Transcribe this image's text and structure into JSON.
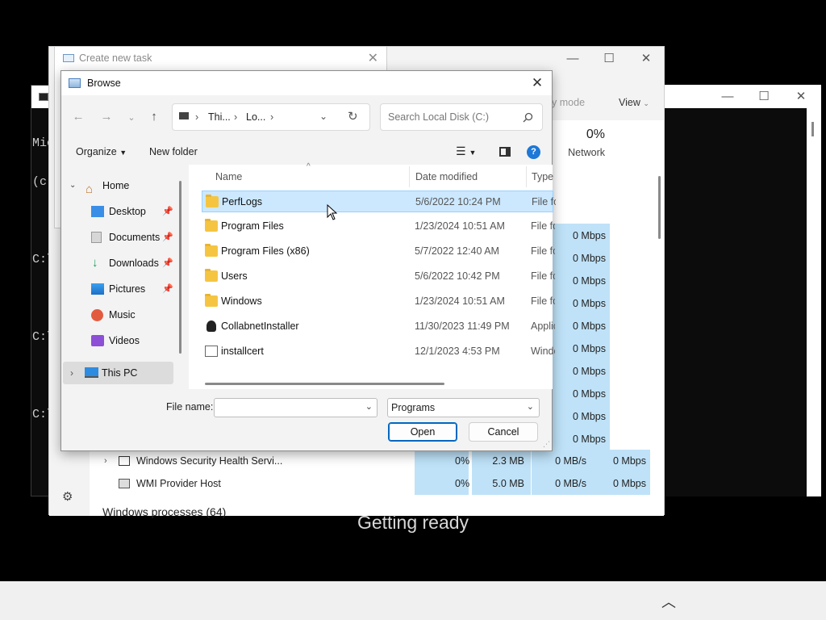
{
  "cmd": {
    "lines": [
      "Mic",
      "(c)",
      "",
      "C:\\",
      "",
      "C:\\",
      "",
      "C:\\"
    ]
  },
  "terminal": {
    "min": "—",
    "max": "☐",
    "close": "✕"
  },
  "task_manager": {
    "min": "—",
    "max": "☐",
    "close": "✕",
    "efficiency_mode": "icy mode",
    "view_label": "View",
    "network_pct": "0%",
    "network_label": "Network",
    "mbps_values": [
      "0 Mbps",
      "0 Mbps",
      "0 Mbps",
      "0 Mbps",
      "0 Mbps",
      "0 Mbps",
      "0 Mbps",
      "0 Mbps",
      "0 Mbps",
      "0 Mbps"
    ],
    "rows": [
      {
        "name": "Windows Security Health Servi...",
        "cpu": "0%",
        "mem": "2.3 MB",
        "disk": "0 MB/s",
        "net": "0 Mbps"
      },
      {
        "name": "WMI Provider Host",
        "cpu": "0%",
        "mem": "5.0 MB",
        "disk": "0 MB/s",
        "net": "0 Mbps"
      }
    ],
    "section": "Windows processes (64)"
  },
  "create_task": {
    "title": "Create new task",
    "close": "✕"
  },
  "browse": {
    "title": "Browse",
    "close": "✕",
    "address": {
      "seg1": "Thi...",
      "seg2": "Lo...",
      "sep": "›"
    },
    "search_placeholder": "Search Local Disk (C:)",
    "organize": "Organize",
    "new_folder": "New folder",
    "nav": [
      {
        "label": "Home",
        "icon": "home-icon"
      },
      {
        "label": "Desktop",
        "icon": "desktop-icon"
      },
      {
        "label": "Documents",
        "icon": "documents-icon"
      },
      {
        "label": "Downloads",
        "icon": "downloads-icon"
      },
      {
        "label": "Pictures",
        "icon": "pictures-icon"
      },
      {
        "label": "Music",
        "icon": "music-icon"
      },
      {
        "label": "Videos",
        "icon": "videos-icon"
      },
      {
        "label": "This PC",
        "icon": "this-pc-icon"
      }
    ],
    "columns": {
      "name": "Name",
      "date": "Date modified",
      "type": "Type"
    },
    "files": [
      {
        "name": "PerfLogs",
        "date": "5/6/2022 10:24 PM",
        "type": "File folder",
        "kind": "folder",
        "selected": true
      },
      {
        "name": "Program Files",
        "date": "1/23/2024 10:51 AM",
        "type": "File folder",
        "kind": "folder"
      },
      {
        "name": "Program Files (x86)",
        "date": "5/7/2022 12:40 AM",
        "type": "File folder",
        "kind": "folder"
      },
      {
        "name": "Users",
        "date": "5/6/2022 10:42 PM",
        "type": "File folder",
        "kind": "folder"
      },
      {
        "name": "Windows",
        "date": "1/23/2024 10:51 AM",
        "type": "File folder",
        "kind": "folder"
      },
      {
        "name": "CollabnetInstaller",
        "date": "11/30/2023 11:49 PM",
        "type": "Application",
        "kind": "app"
      },
      {
        "name": "installcert",
        "date": "12/1/2023 4:53 PM",
        "type": "Windows",
        "kind": "script"
      }
    ],
    "file_name_label": "File name:",
    "file_name_value": "",
    "filter": "Programs",
    "open": "Open",
    "cancel": "Cancel"
  },
  "status": "Getting ready",
  "colors": {
    "selection": "#cce8ff",
    "highlight": "#bfe2f8",
    "accent": "#0067c0"
  }
}
